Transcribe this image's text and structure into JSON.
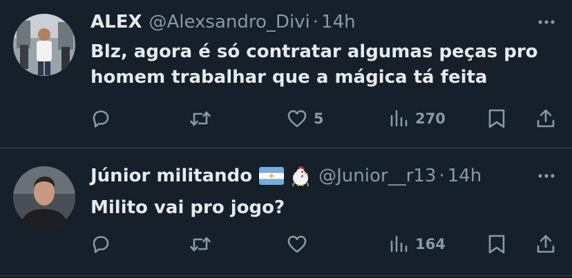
{
  "tweets": [
    {
      "display_name": "ALEX",
      "handle": "@Alexsandro_Divi",
      "separator": "·",
      "time": "14h",
      "text_lines": [
        "Blz, agora é só contratar algumas peças pro",
        "homem trabalhar que a mágica tá feita"
      ],
      "actions": {
        "reply_count": "",
        "retweet_count": "",
        "like_count": "5",
        "view_count": "270"
      }
    },
    {
      "display_name": "Júnior militando",
      "name_emojis": [
        "argentina-flag",
        "rooster"
      ],
      "handle": "@Junior__r13",
      "separator": "·",
      "time": "14h",
      "text_lines": [
        "Milito vai pro jogo?"
      ],
      "actions": {
        "reply_count": "",
        "retweet_count": "",
        "like_count": "",
        "view_count": "164"
      }
    }
  ],
  "colors": {
    "background": "#15202b",
    "primary_text": "#e7e9ea",
    "secondary_text": "#8b98a5",
    "divider": "#38444d"
  },
  "icons": [
    "more-icon",
    "reply-icon",
    "retweet-icon",
    "like-icon",
    "views-icon",
    "bookmark-icon",
    "share-icon"
  ]
}
